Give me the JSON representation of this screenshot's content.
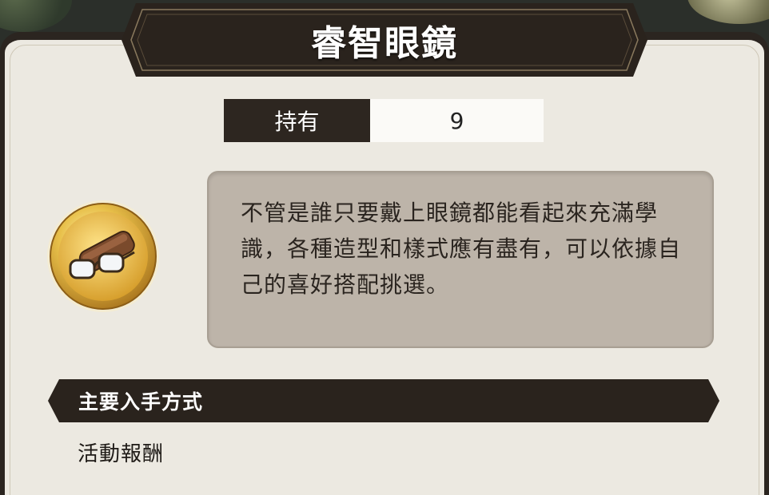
{
  "item": {
    "name": "睿智眼鏡",
    "owned_label": "持有",
    "owned_count": "9",
    "icon": "glasses-icon",
    "description": "不管是誰只要戴上眼鏡都能看起來充滿學識，各種造型和樣式應有盡有，可以依據自己的喜好搭配挑選。"
  },
  "acquisition": {
    "header": "主要入手方式",
    "sources": [
      "活動報酬"
    ]
  },
  "colors": {
    "panel_bg": "#ece9e1",
    "dark_banner": "#2b2520",
    "desc_box": "#bdb4a9",
    "coin_gold": "#e8c04a"
  }
}
